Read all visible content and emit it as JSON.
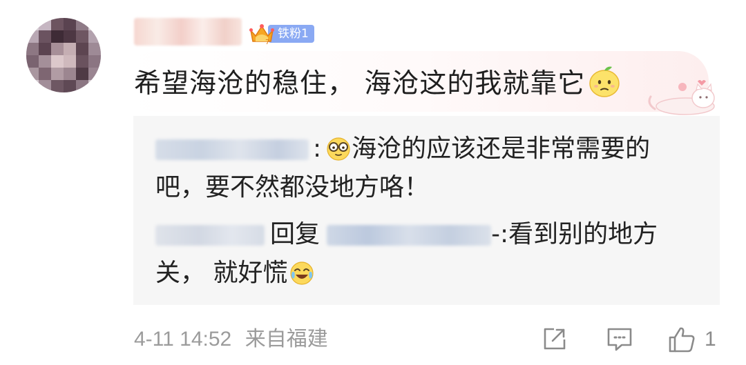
{
  "comment": {
    "badge_label": "铁粉1",
    "text": "希望海沧的稳住， 海沧这的我就靠它"
  },
  "replies": {
    "first": {
      "separator": ":",
      "text_line1": "海沧的应该还是非常需要的",
      "text_line2": "吧，要不然都没地方咯！"
    },
    "second": {
      "reply_word": "回复",
      "suffix": "-:看到别的地方",
      "text_line2": "关， 就好慌"
    }
  },
  "footer": {
    "timestamp": "4-11 14:52",
    "source": "来自福建",
    "like_count": "1"
  },
  "colors": {
    "badge": "#8aa9f3",
    "reply_bg": "#f6f6f6",
    "meta_text": "#9b9b9b"
  },
  "icons": {
    "share": "share-icon",
    "comment": "comment-icon",
    "like": "thumbs-up-icon"
  }
}
